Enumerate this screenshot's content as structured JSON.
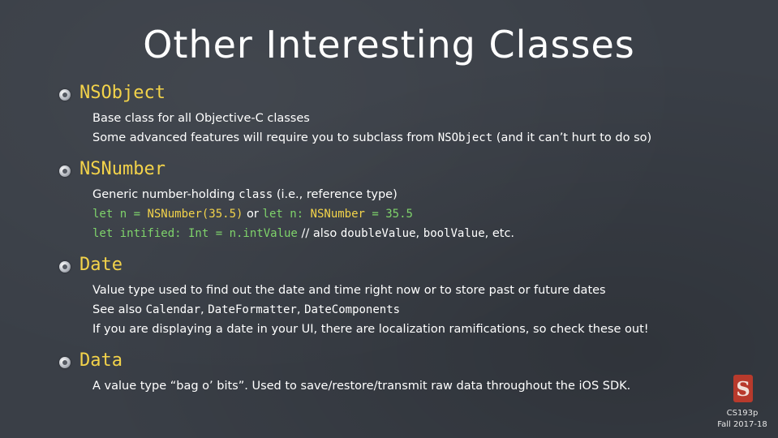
{
  "slide": {
    "title": "Other Interesting Classes",
    "sections": [
      {
        "heading": "NSObject",
        "lines": [
          [
            "Base class for all Objective-C classes"
          ],
          [
            "Some advanced features will require you to subclass from ",
            "NSObject",
            " (and it can’t hurt to do so)"
          ]
        ]
      },
      {
        "heading": "NSNumber",
        "lines": [
          [
            "Generic number-holding ",
            "class",
            " (i.e., reference type)"
          ],
          [
            "let n = ",
            "NSNumber(35.5)",
            " or ",
            "let n: ",
            "NSNumber",
            " = 35.5"
          ],
          [
            "let intified: Int = n.intValue",
            " // also ",
            "doubleValue",
            ", ",
            "boolValue",
            ", etc."
          ]
        ]
      },
      {
        "heading": "Date",
        "lines": [
          [
            "Value type used to find out the date and time right now or to store past or future dates"
          ],
          [
            "See also ",
            "Calendar",
            ", ",
            "DateFormatter",
            ", ",
            "DateComponents"
          ],
          [
            "If you are displaying a date in your UI, there are localization ramifications, so check these out!"
          ]
        ]
      },
      {
        "heading": "Data",
        "lines": [
          [
            "A value type “bag o’ bits”.  Used to save/restore/transmit raw data throughout the iOS SDK."
          ]
        ]
      }
    ],
    "logo_letter": "S",
    "course": "CS193p",
    "term": "Fall 2017-18"
  },
  "colors": {
    "background": "#3a3f47",
    "heading": "#f3d34a",
    "code_keyword": "#7fd36b",
    "body_text": "#ffffff"
  }
}
